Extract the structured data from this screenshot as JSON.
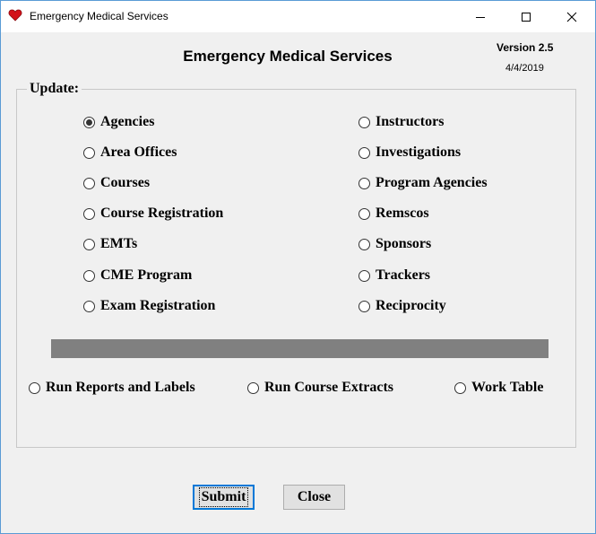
{
  "window": {
    "title": "Emergency Medical Services",
    "icon": "heart-icon",
    "controls": {
      "minimize": "minimize-icon",
      "maximize": "maximize-icon",
      "close": "close-icon"
    }
  },
  "header": {
    "title": "Emergency Medical Services",
    "version": "Version 2.5",
    "date": "4/4/2019"
  },
  "update_group": {
    "label": "Update:",
    "left_options": [
      {
        "label": "Agencies",
        "checked": true
      },
      {
        "label": "Area Offices",
        "checked": false
      },
      {
        "label": "Courses",
        "checked": false
      },
      {
        "label": "Course Registration",
        "checked": false
      },
      {
        "label": "EMTs",
        "checked": false
      },
      {
        "label": "CME Program",
        "checked": false
      },
      {
        "label": "Exam Registration",
        "checked": false
      }
    ],
    "right_options": [
      {
        "label": "Instructors",
        "checked": false
      },
      {
        "label": "Investigations",
        "checked": false
      },
      {
        "label": "Program Agencies",
        "checked": false
      },
      {
        "label": "Remscos",
        "checked": false
      },
      {
        "label": "Sponsors",
        "checked": false
      },
      {
        "label": "Trackers",
        "checked": false
      },
      {
        "label": "Reciprocity",
        "checked": false
      }
    ],
    "bottom_options": [
      {
        "label": "Run Reports and Labels",
        "checked": false
      },
      {
        "label": "Run Course Extracts",
        "checked": false
      },
      {
        "label": "Work Table",
        "checked": false
      }
    ]
  },
  "buttons": {
    "submit": "Submit",
    "close": "Close"
  },
  "colors": {
    "accent": "#0078d7",
    "heart": "#d3121a",
    "bar": "#808080"
  }
}
